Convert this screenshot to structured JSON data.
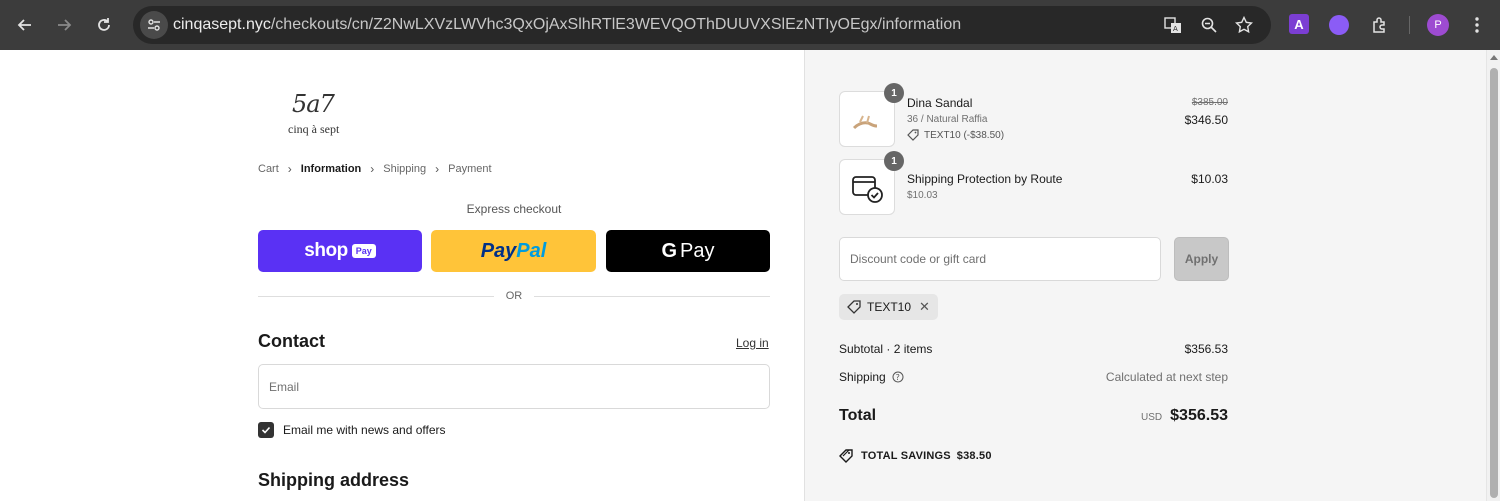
{
  "browser": {
    "url_host": "cinqasept.nyc",
    "url_path": "/checkouts/cn/Z2NwLXVzLWVhc3QxOjAxSlhRTlE3WEVQOThDUUVXSlEzNTIyOEgx/information",
    "extension_a_label": "A",
    "profile_initial": "P",
    "icons": [
      "back-icon",
      "forward-icon",
      "reload-icon",
      "site-info-icon",
      "translate-icon",
      "zoom-icon",
      "star-icon",
      "extensions-icon",
      "menu-icon"
    ]
  },
  "checkout": {
    "logo_top": "5a7",
    "logo_bottom": "cinq à sept",
    "breadcrumb": {
      "cart": "Cart",
      "information": "Information",
      "shipping": "Shipping",
      "payment": "Payment"
    },
    "express_label": "Express checkout",
    "shop_pay": {
      "word": "shop",
      "badge": "Pay"
    },
    "paypal": {
      "part1": "Pay",
      "part2": "Pal"
    },
    "gpay": {
      "g": "G",
      "word": "Pay"
    },
    "or_label": "OR",
    "contact_heading": "Contact",
    "login_link": "Log in",
    "email_placeholder": "Email",
    "newsletter_label": "Email me with news and offers",
    "newsletter_checked": true,
    "shipping_heading": "Shipping address"
  },
  "summary": {
    "items": [
      {
        "name": "Dina Sandal",
        "variant": "36 / Natural Raffia",
        "discount": "TEXT10 (-$38.50)",
        "original_price": "$385.00",
        "price": "$346.50",
        "quantity": "1"
      },
      {
        "name": "Shipping Protection by Route",
        "variant": "$10.03",
        "price": "$10.03",
        "quantity": "1"
      }
    ],
    "discount_placeholder": "Discount code or gift card",
    "apply_label": "Apply",
    "applied_code": "TEXT10",
    "subtotal_label": "Subtotal · 2 items",
    "subtotal_value": "$356.53",
    "shipping_label": "Shipping",
    "shipping_value": "Calculated at next step",
    "total_label": "Total",
    "currency": "USD",
    "total_value": "$356.53",
    "savings_label": "TOTAL SAVINGS",
    "savings_value": "$38.50"
  },
  "colors": {
    "shop_pay": "#5a31f4",
    "paypal": "#ffc439",
    "gpay": "#000000",
    "chrome_bar": "#3c3c3c"
  }
}
